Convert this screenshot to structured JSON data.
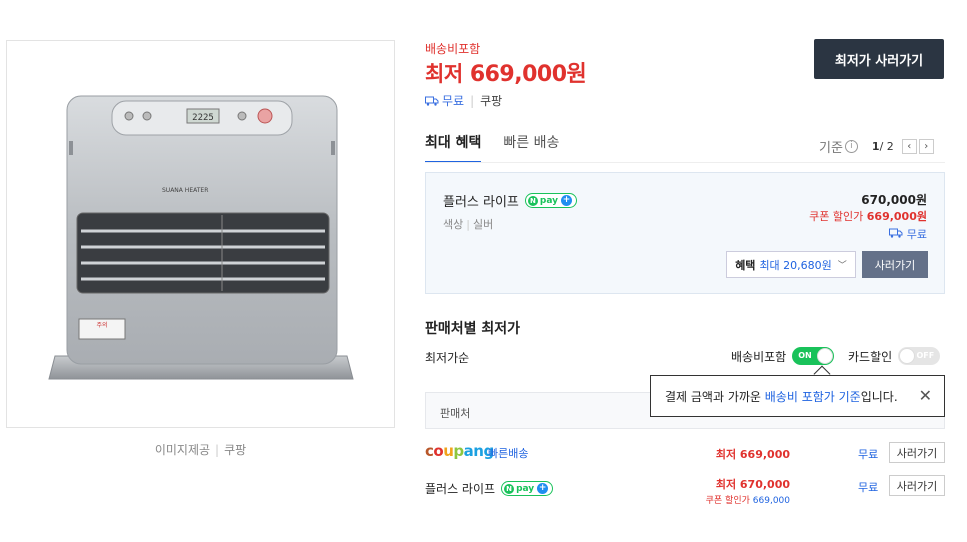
{
  "image": {
    "credit_label": "이미지제공",
    "credit_source": "쿠팡",
    "product_brand_label": "SUANA HEATER",
    "panel_display": "2225",
    "warning_label": "주의"
  },
  "price": {
    "shipping_included": "배송비포함",
    "lowest_label": "최저",
    "lowest_value": "669,000원",
    "delivery_free": "무료",
    "delivery_seller": "쿠팡",
    "buy_button": "최저가 사러가기"
  },
  "tabs": [
    {
      "label": "최대 혜택"
    },
    {
      "label": "빠른 배송"
    }
  ],
  "pager": {
    "criteria_label": "기준",
    "current": "1",
    "total": "/ 2",
    "prev": "‹",
    "next": "›"
  },
  "benefit_card": {
    "seller": "플러스 라이프",
    "npay_text": "pay",
    "option_label": "색상",
    "option_value": "실버",
    "price": "670,000원",
    "coupon_label": "쿠폰 할인가",
    "coupon_price": "669,000원",
    "shipping": "무료",
    "benefit_label": "혜택",
    "benefit_value": "최대 20,680원",
    "buy_button": "사러가기"
  },
  "seller_section": {
    "title": "판매처별 최저가",
    "sort_label": "최저가순",
    "toggle_shipping_label": "배송비포함",
    "toggle_shipping_state": "ON",
    "toggle_card_label": "카드할인",
    "toggle_card_state": "OFF",
    "table_header": "판매처",
    "tooltip_prefix": "결제 금액과 가까운 ",
    "tooltip_highlight": "배송비 포함가 기준",
    "tooltip_suffix": "입니다.",
    "tooltip_close": "✕"
  },
  "rows": [
    {
      "seller": "coupang",
      "badge": "빠른배송",
      "price": "최저 669,000",
      "shipping": "무료",
      "buy": "사러가기"
    },
    {
      "seller": "플러스 라이프",
      "price": "최저 670,000",
      "coupon_label": "쿠폰 할인가",
      "coupon_price": "669,000",
      "shipping": "무료",
      "buy": "사러가기"
    }
  ],
  "colors": {
    "price_red": "#e0322e",
    "link_blue": "#1f63e0",
    "npay_green": "#19c25a",
    "dark_button": "#2b3542"
  }
}
